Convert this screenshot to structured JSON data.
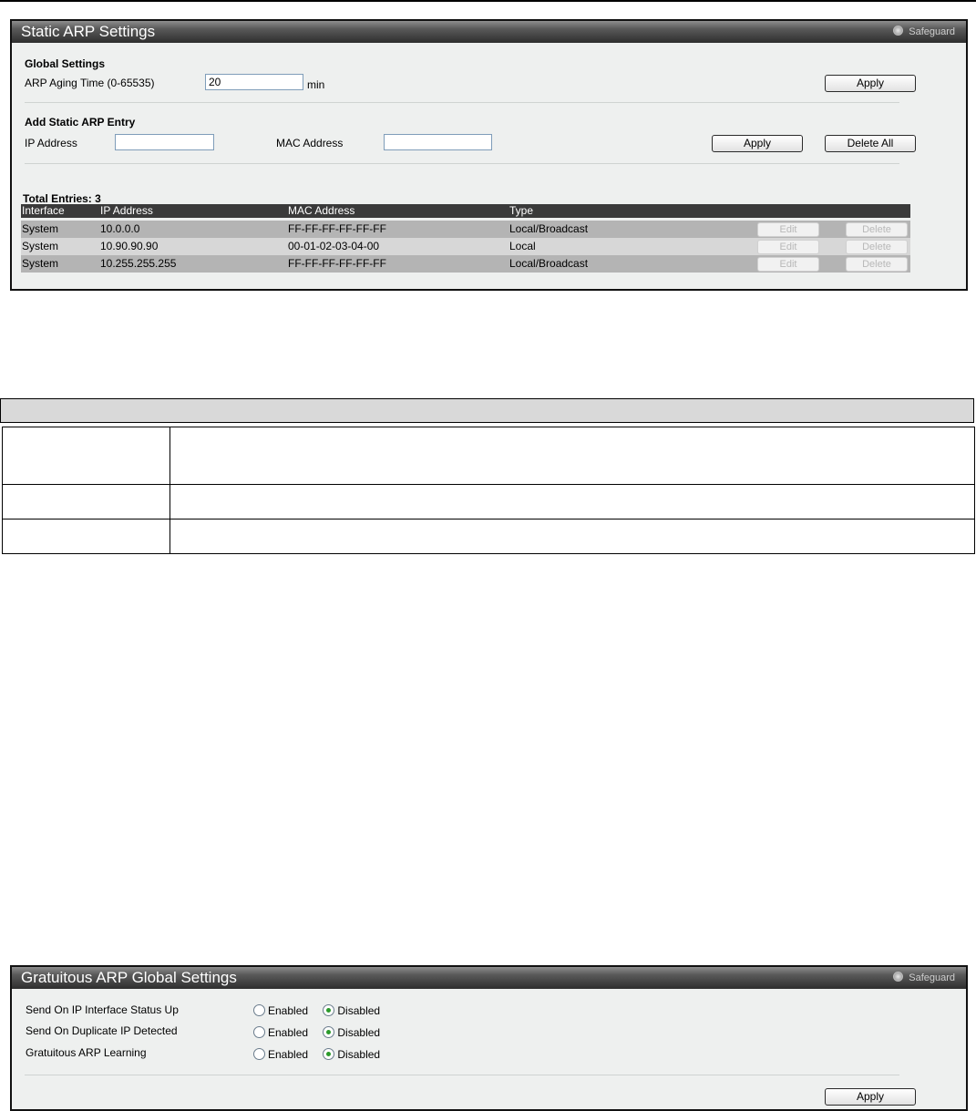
{
  "static_arp": {
    "title": "Static ARP Settings",
    "safeguard_label": "Safeguard",
    "global": {
      "heading": "Global Settings",
      "aging_label": "ARP Aging Time (0-65535)",
      "aging_value": "20",
      "aging_unit": "min",
      "apply_label": "Apply"
    },
    "add_entry": {
      "heading": "Add Static ARP Entry",
      "ip_label": "IP Address",
      "ip_value": "",
      "mac_label": "MAC Address",
      "mac_value": "",
      "apply_label": "Apply",
      "delete_all_label": "Delete All"
    },
    "total_entries": "Total Entries: 3",
    "table": {
      "columns": [
        "Interface",
        "IP Address",
        "MAC Address",
        "Type"
      ],
      "rows": [
        {
          "interface": "System",
          "ip": "10.0.0.0",
          "mac": "FF-FF-FF-FF-FF-FF",
          "type": "Local/Broadcast",
          "edit": "Edit",
          "delete": "Delete"
        },
        {
          "interface": "System",
          "ip": "10.90.90.90",
          "mac": "00-01-02-03-04-00",
          "type": "Local",
          "edit": "Edit",
          "delete": "Delete"
        },
        {
          "interface": "System",
          "ip": "10.255.255.255",
          "mac": "FF-FF-FF-FF-FF-FF",
          "type": "Local/Broadcast",
          "edit": "Edit",
          "delete": "Delete"
        }
      ]
    }
  },
  "gratuitous_arp": {
    "title": "Gratuitous ARP Global Settings",
    "safeguard_label": "Safeguard",
    "settings": [
      {
        "label": "Send On IP Interface Status Up",
        "enabled_label": "Enabled",
        "disabled_label": "Disabled",
        "selected": "Disabled"
      },
      {
        "label": "Send On Duplicate IP Detected",
        "enabled_label": "Enabled",
        "disabled_label": "Disabled",
        "selected": "Disabled"
      },
      {
        "label": "Gratuitous ARP Learning",
        "enabled_label": "Enabled",
        "disabled_label": "Disabled",
        "selected": "Disabled"
      }
    ],
    "apply_label": "Apply"
  }
}
